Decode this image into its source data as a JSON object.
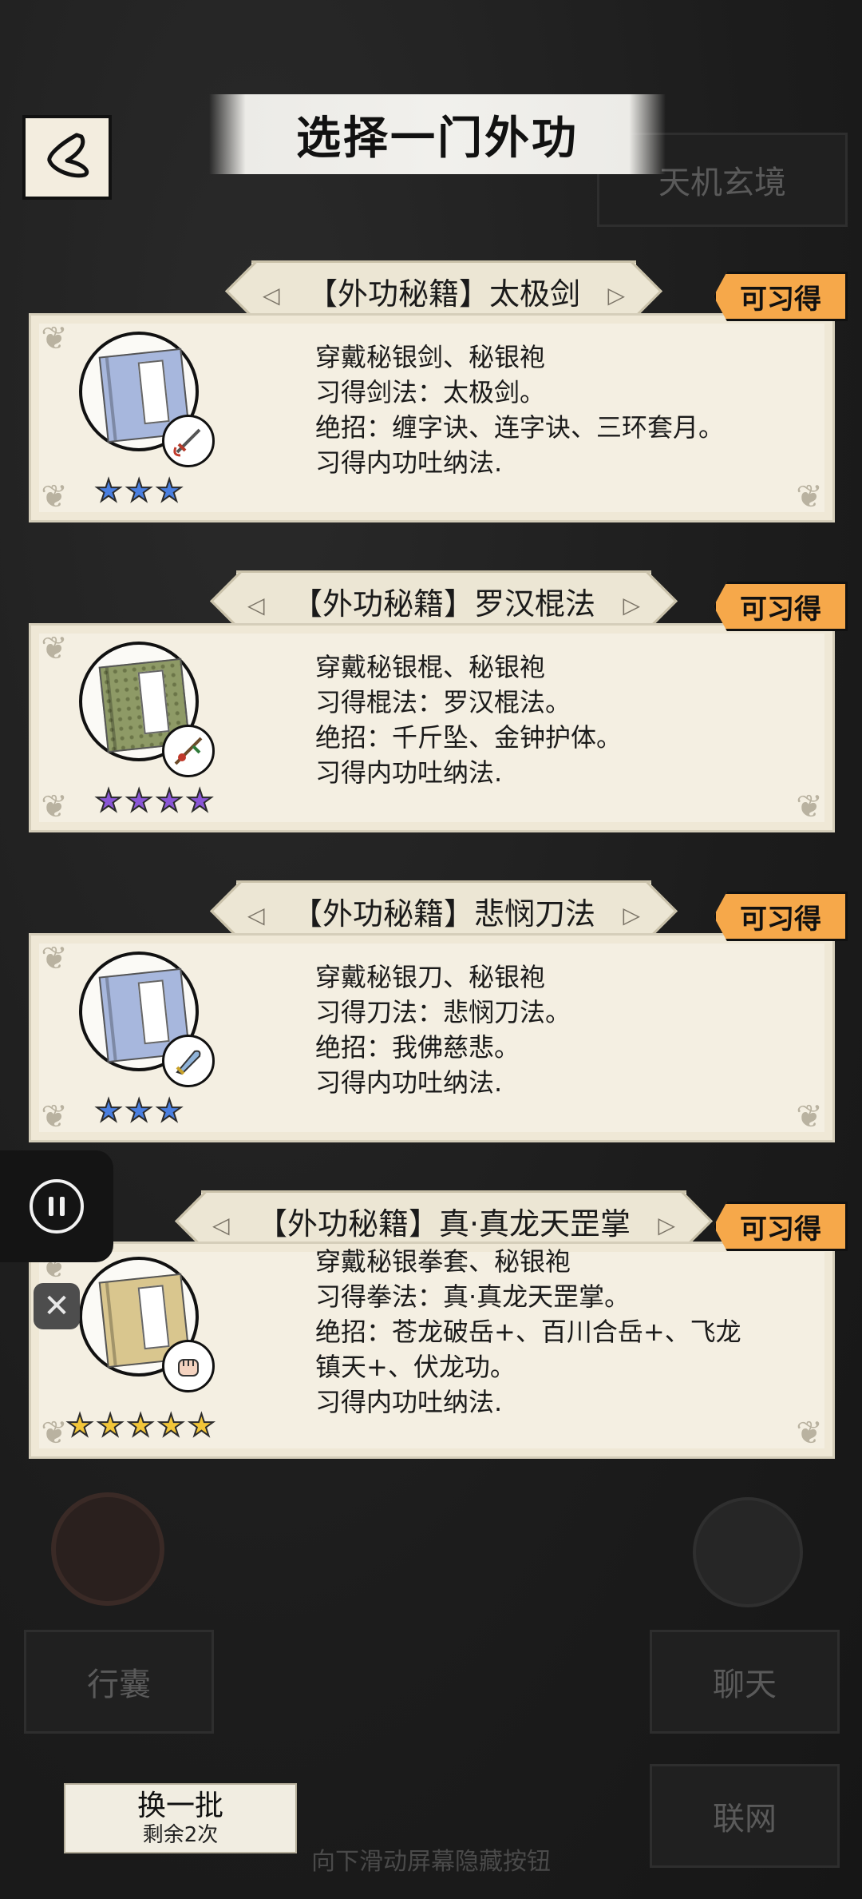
{
  "screen_title": "选择一门外功",
  "background": {
    "top_right_button": "天机玄境",
    "bag_button": "行囊",
    "chat_button": "聊天",
    "network_button": "联网",
    "hint_text": "向下滑动屏幕隐藏按钮"
  },
  "cards": [
    {
      "title": "【外功秘籍】太极剑",
      "badge": "可习得",
      "book_color": "#a7b7dd",
      "star_color": "#4a7fe0",
      "stars": 3,
      "weapon_icon": "sword-icon",
      "desc": [
        "穿戴秘银剑、秘银袍",
        "习得剑法：太极剑。",
        "绝招：缠字诀、连字诀、三环套月。",
        "习得内功吐纳法."
      ]
    },
    {
      "title": "【外功秘籍】罗汉棍法",
      "badge": "可习得",
      "book_color": "#8e9a66",
      "star_color": "#8a56d6",
      "stars": 4,
      "weapon_icon": "staff-icon",
      "desc": [
        "穿戴秘银棍、秘银袍",
        "习得棍法：罗汉棍法。",
        "绝招：千斤坠、金钟护体。",
        "习得内功吐纳法."
      ]
    },
    {
      "title": "【外功秘籍】悲悯刀法",
      "badge": "可习得",
      "book_color": "#a7b7dd",
      "star_color": "#4a7fe0",
      "stars": 3,
      "weapon_icon": "blade-icon",
      "desc": [
        "穿戴秘银刀、秘银袍",
        "习得刀法：悲悯刀法。",
        "绝招：我佛慈悲。",
        "习得内功吐纳法."
      ]
    },
    {
      "title": "【外功秘籍】真·真龙天罡掌",
      "badge": "可习得",
      "book_color": "#d9c68e",
      "star_color": "#f2c63a",
      "stars": 5,
      "weapon_icon": "fist-icon",
      "desc": [
        "穿戴秘银拳套、秘银袍",
        "习得拳法：真·真龙天罡掌。",
        "绝招：苍龙破岳+、百川合岳+、飞龙",
        "镇天+、伏龙功。",
        "习得内功吐纳法."
      ]
    }
  ],
  "refresh": {
    "label": "换一批",
    "remaining": "剩余2次"
  }
}
